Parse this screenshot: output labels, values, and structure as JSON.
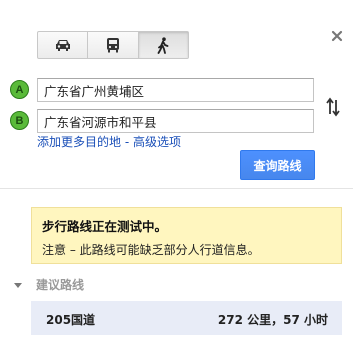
{
  "travel_modes": [
    {
      "name": "car-icon",
      "active": false
    },
    {
      "name": "transit-icon",
      "active": false
    },
    {
      "name": "walking-icon",
      "active": true
    }
  ],
  "waypoints": [
    {
      "marker": "A",
      "value": "广东省广州黄埔区"
    },
    {
      "marker": "B",
      "value": "广东省河源市和平县"
    }
  ],
  "links": {
    "add_destination": "添加更多目的地",
    "separator": " - ",
    "advanced": "高级选项"
  },
  "search_button": "查询路线",
  "warning": {
    "title": "步行路线正在测试中。",
    "text": "注意 – 此路线可能缺乏部分人行道信息。"
  },
  "suggested": {
    "label": "建议路线",
    "routes": [
      {
        "name": "205国道",
        "info": "272 公里，57 小时"
      }
    ]
  },
  "colors": {
    "accent_button": "#4d90fe",
    "marker_green": "#5aba3a",
    "warning_bg": "#fff6bf",
    "route_bg": "#e8ecf7",
    "link": "#1a4fb8"
  }
}
